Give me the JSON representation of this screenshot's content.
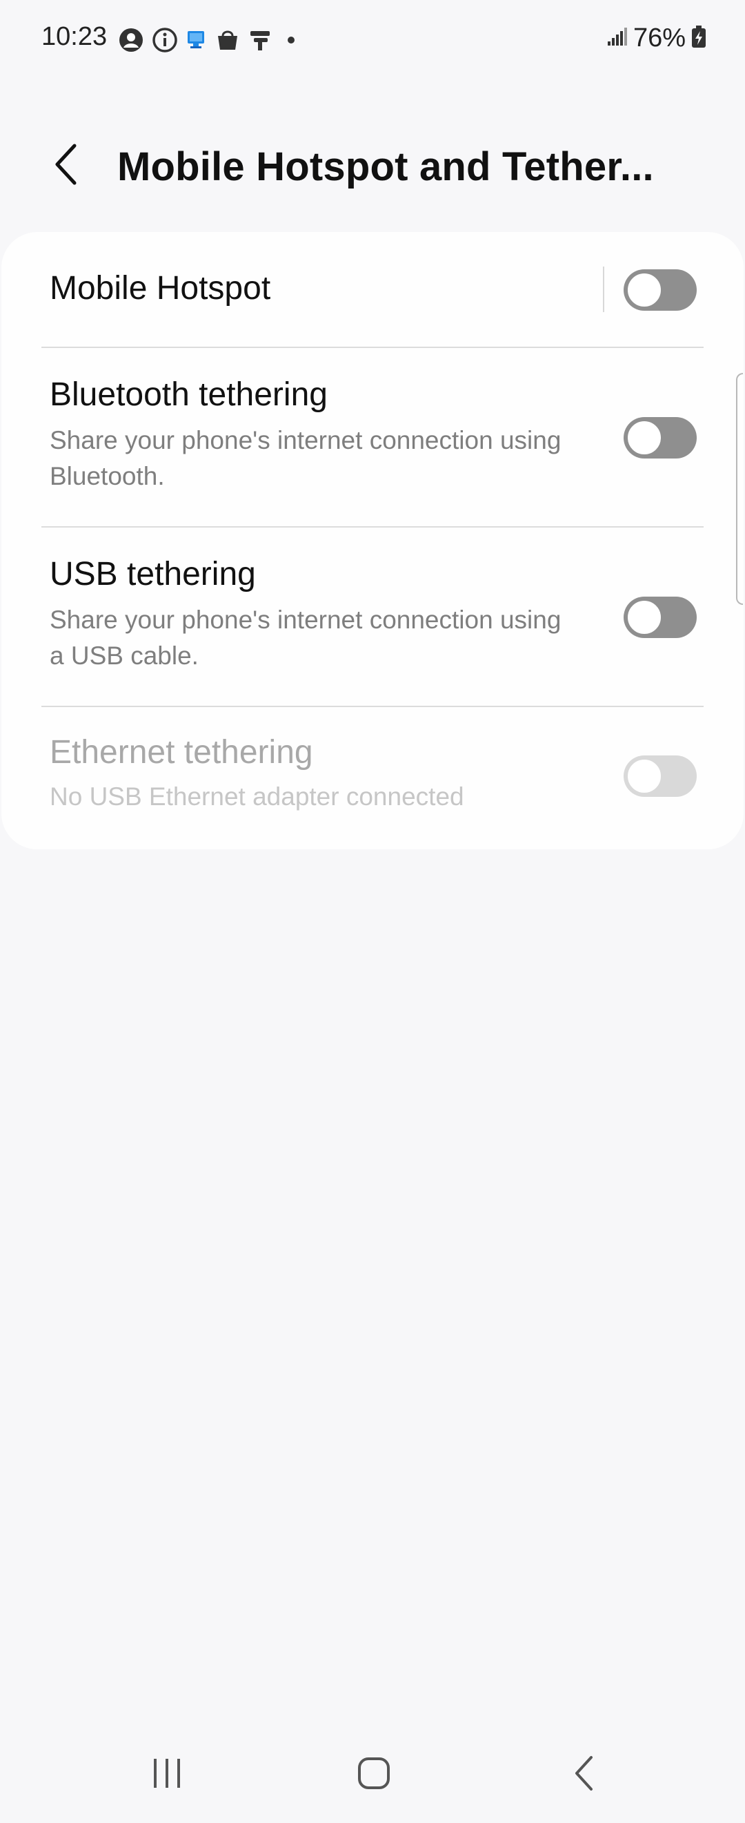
{
  "status_bar": {
    "time": "10:23",
    "battery_percent": "76%",
    "icons": [
      "account-icon",
      "info-icon",
      "remote-desktop-icon",
      "shopping-bag-icon",
      "flag-icon",
      "dot-icon",
      "signal-icon",
      "battery-charging-icon"
    ]
  },
  "header": {
    "title": "Mobile Hotspot and Tether...",
    "back_icon": "chevron-left-icon"
  },
  "settings": [
    {
      "title": "Mobile Hotspot",
      "subtitle": "",
      "enabled": false,
      "disabled": false
    },
    {
      "title": "Bluetooth tethering",
      "subtitle": "Share your phone's internet connection using Bluetooth.",
      "enabled": false,
      "disabled": false
    },
    {
      "title": "USB tethering",
      "subtitle": "Share your phone's internet connection using a USB cable.",
      "enabled": false,
      "disabled": false
    },
    {
      "title": "Ethernet tethering",
      "subtitle": "No USB Ethernet adapter connected",
      "enabled": false,
      "disabled": true
    }
  ],
  "nav_bar": {
    "icons": [
      "recent-apps-icon",
      "home-icon",
      "back-icon"
    ]
  },
  "colors": {
    "background": "#f7f7f9",
    "card": "#fefefe",
    "toggle_off": "#8f8f8f",
    "toggle_disabled": "#d9d9d9"
  }
}
